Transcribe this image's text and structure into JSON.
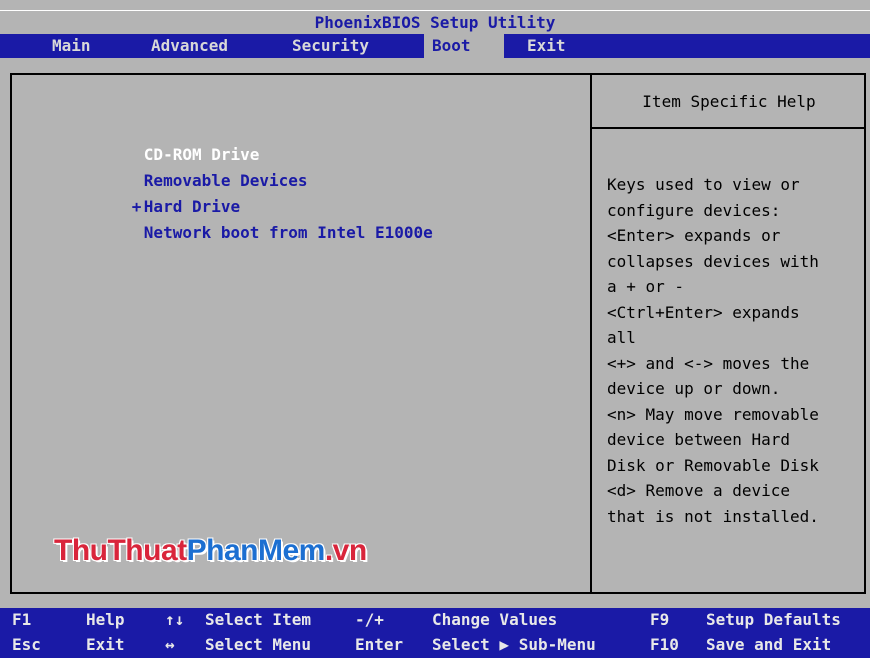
{
  "header": {
    "title": "PhoenixBIOS Setup Utility"
  },
  "menu": {
    "tabs": [
      {
        "label": "Main"
      },
      {
        "label": "Advanced"
      },
      {
        "label": "Security"
      },
      {
        "label": "Boot"
      },
      {
        "label": "Exit"
      }
    ],
    "active": "Boot"
  },
  "boot_list": {
    "items": [
      {
        "prefix": "",
        "label": "CD-ROM Drive",
        "selected": true
      },
      {
        "prefix": "",
        "label": "Removable Devices",
        "selected": false
      },
      {
        "prefix": "+",
        "label": "Hard Drive",
        "selected": false
      },
      {
        "prefix": "",
        "label": "Network boot from Intel E1000e",
        "selected": false
      }
    ]
  },
  "help": {
    "title": "Item Specific Help",
    "lines": [
      "Keys used to view or",
      "configure devices:",
      "<Enter> expands or",
      "collapses devices with",
      "a + or -",
      "<Ctrl+Enter> expands",
      "all",
      "<+> and <-> moves the",
      "device up or down.",
      "<n> May move removable",
      "device between Hard",
      "Disk or Removable Disk",
      "<d> Remove a device",
      "that is not installed."
    ]
  },
  "watermark": {
    "part1": "ThuThuat",
    "part2": "PhanMem",
    "part3": ".vn"
  },
  "footer": {
    "row1": {
      "key1": "F1",
      "desc1": "Help",
      "key2": "↑↓",
      "desc2": "Select Item",
      "key3": "-/+",
      "desc3": "Change Values",
      "key4": "F9",
      "desc4": "Setup Defaults"
    },
    "row2": {
      "key1": "Esc",
      "desc1": "Exit",
      "key2": "↔",
      "desc2": "Select Menu",
      "key3": "Enter",
      "desc3": "Select ▶ Sub-Menu",
      "key4": "F10",
      "desc4": "Save and Exit"
    }
  },
  "colors": {
    "background": "#b4b4b4",
    "bar_blue": "#1a1aa6",
    "selected_text": "#ffffff",
    "item_text": "#1a1aa6"
  }
}
